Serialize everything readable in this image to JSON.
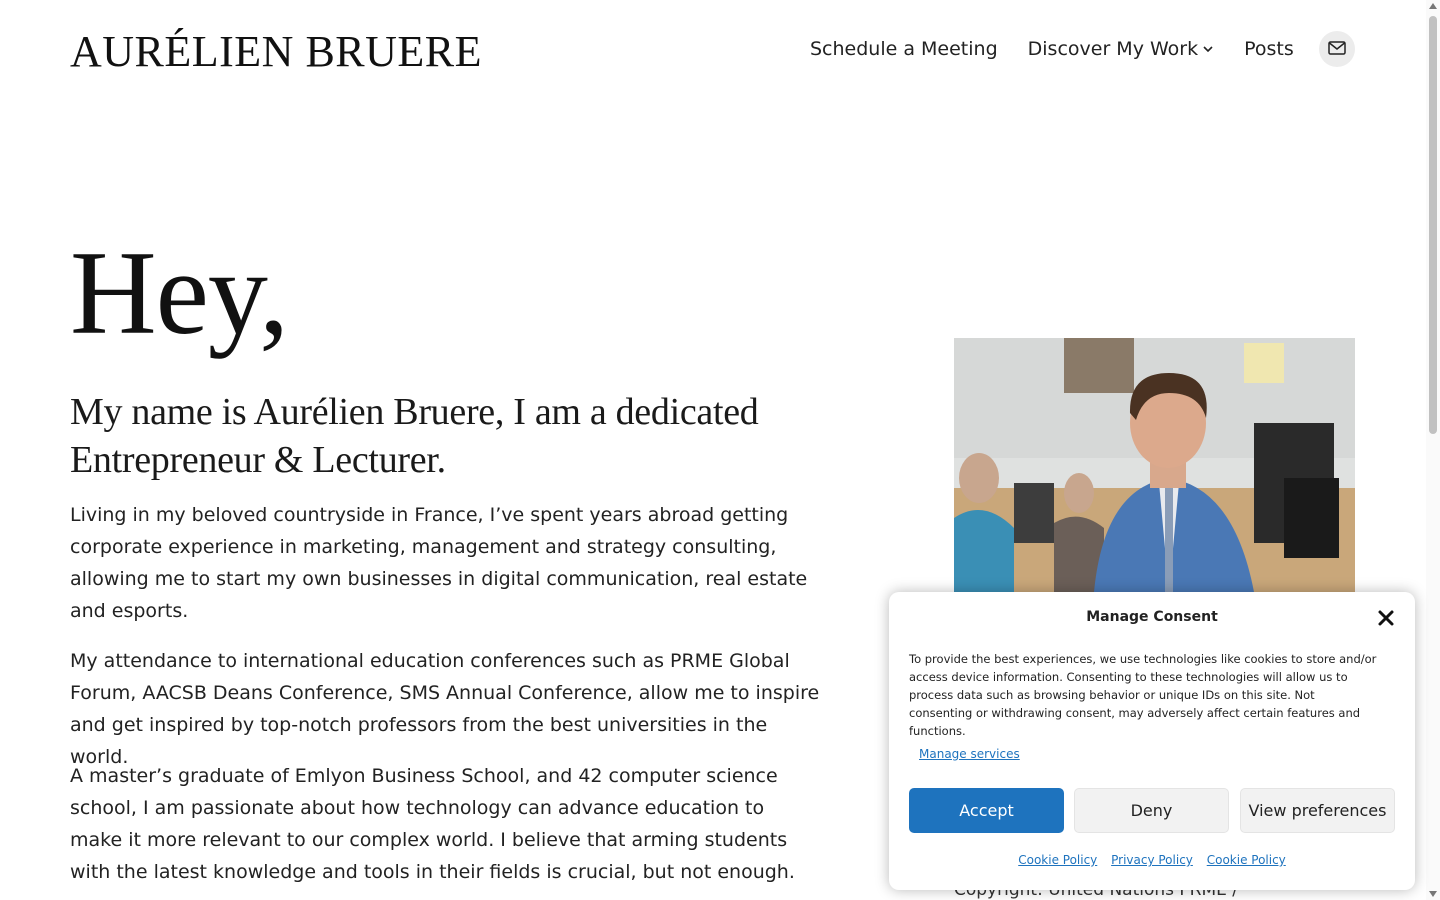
{
  "header": {
    "site_title": "AURÉLIEN BRUERE",
    "nav": [
      "Schedule a Meeting",
      "Discover My Work",
      "Posts"
    ],
    "mail_icon": "mail-icon"
  },
  "main": {
    "greeting": "Hey,",
    "intro": "My name is Aurélien Bruere, I am a dedicated Entrepreneur & Lecturer.",
    "paragraphs": [
      "Living in my beloved countryside in France, I’ve spent years abroad getting corporate experience in marketing, management and strategy consulting, allowing me to start my own businesses in digital communication, real estate and esports.",
      "My attendance to international education conferences such as PRME Global Forum, AACSB Deans Conference, SMS Annual Conference, allow me to inspire and get inspired by top-notch professors from the best universities in the world.",
      "A master’s graduate of Emlyon Business School, and 42 computer science school, I am passionate about how technology can advance education to make it more relevant to our complex world. I believe that arming students with the latest knowledge and tools in their fields is crucial, but not enough."
    ],
    "photo_caption": "Copyright: United Nations PRME /"
  },
  "consent": {
    "title": "Manage Consent",
    "text": "To provide the best experiences, we use technologies like cookies to store and/or access device information. Consenting to these technologies will allow us to process data such as browsing behavior or unique IDs on this site. Not consenting or withdrawing consent, may adversely affect certain features and functions.",
    "manage_services": "Manage services",
    "accept": "Accept",
    "deny": "Deny",
    "view_preferences": "View preferences",
    "links": [
      "Cookie Policy",
      "Privacy Policy",
      "Cookie Policy"
    ]
  },
  "colors": {
    "accent": "#1e73be",
    "text": "#1f1f1f",
    "button_bg": "#f2f2f2"
  }
}
